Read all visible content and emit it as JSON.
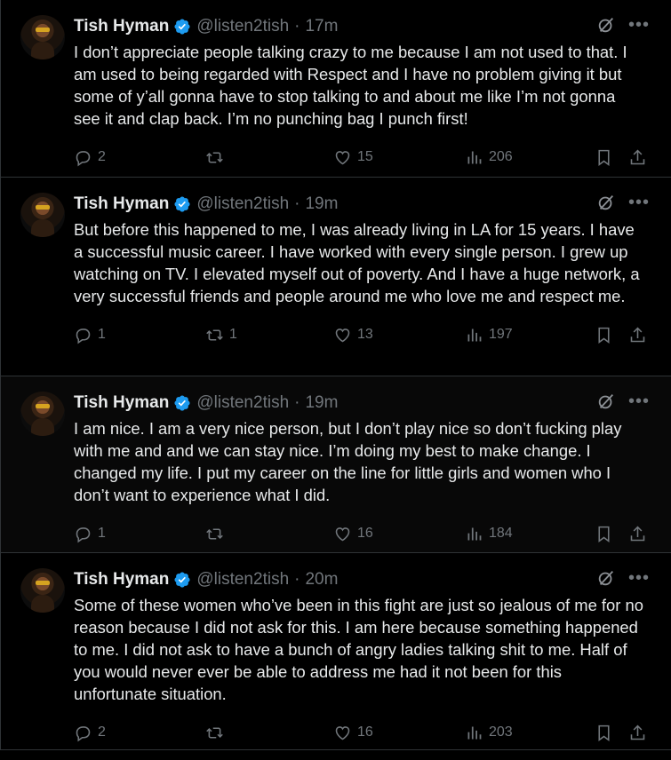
{
  "tweets": [
    {
      "name": "Tish Hyman",
      "handle": "@listen2tish",
      "time": "17m",
      "text": "I don’t appreciate people talking crazy to me because I am not used to that. I am used to being regarded with Respect and I have no problem giving it but some of y’all gonna have to stop talking to and about me like I’m not gonna see it and clap back. I’m no punching bag I punch first!",
      "replies": "2",
      "retweets": "",
      "likes": "15",
      "views": "206"
    },
    {
      "name": "Tish Hyman",
      "handle": "@listen2tish",
      "time": "19m",
      "text": "But before this happened to me, I was already living in LA for 15 years. I have a successful music career. I have worked with every single person. I grew up watching on TV. I elevated myself out of poverty. And I have a huge network, a very successful friends and people around me who love me and respect me.",
      "replies": "1",
      "retweets": "1",
      "likes": "13",
      "views": "197"
    },
    {
      "name": "Tish Hyman",
      "handle": "@listen2tish",
      "time": "19m",
      "text": "I am nice. I am a very nice person, but I don’t play nice so don’t fucking play with me and and we can stay nice. I’m doing my best to make change. I changed my life. I put my career on the line for little girls and women who I don’t want to experience what I did.",
      "replies": "1",
      "retweets": "",
      "likes": "16",
      "views": "184"
    },
    {
      "name": "Tish Hyman",
      "handle": "@listen2tish",
      "time": "20m",
      "text": "Some of these women who’ve been in this fight are just so jealous of me for no reason because I did not ask for this. I am here because something happened to me. I did not ask to have a bunch of angry ladies talking shit to me. Half of you would never ever be able to address me had it not been for this unfortunate situation.",
      "replies": "2",
      "retweets": "",
      "likes": "16",
      "views": "203"
    }
  ],
  "separator": "·",
  "icons": {
    "verified": "verified-badge-icon",
    "grok": "grok-icon",
    "more": "more-icon",
    "reply": "reply-icon",
    "retweet": "retweet-icon",
    "like": "heart-icon",
    "views": "views-icon",
    "bookmark": "bookmark-icon",
    "share": "share-icon"
  },
  "colors": {
    "background": "#000000",
    "text": "#e7e9ea",
    "muted": "#71767b",
    "verified": "#1d9bf0",
    "divider": "#2f3336"
  }
}
